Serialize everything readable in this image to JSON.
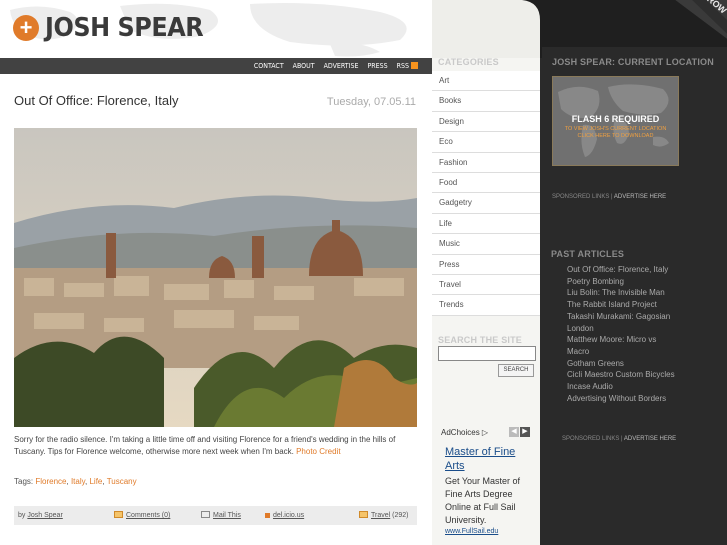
{
  "brand": {
    "logo_symbol": "+",
    "name": "JOSH SPEAR",
    "accent": "#e07b2a"
  },
  "nav": {
    "items": [
      "CONTACT",
      "ABOUT",
      "ADVERTISE",
      "PRESS",
      "RSS"
    ]
  },
  "post": {
    "title": "Out Of Office: Florence, Italy",
    "date": "Tuesday, 07.05.11",
    "body": "Sorry for the radio silence.  I'm taking a little time off and visiting Florence for a friend's wedding in the hills of Tuscany.  Tips for Florence welcome, otherwise more next week when I'm back.",
    "credit": "Photo Credit",
    "tags_label": "Tags:",
    "tags": [
      "Florence",
      "Italy",
      "Life",
      "Tuscany"
    ],
    "footer": {
      "by_label": "by",
      "author": "Josh Spear",
      "comments": "Comments (0)",
      "mail": "Mail This",
      "delicious": "del.icio.us",
      "category": "Travel",
      "category_count": "(292)"
    }
  },
  "categories": {
    "heading": "CATEGORIES",
    "items": [
      "Art",
      "Books",
      "Design",
      "Eco",
      "Fashion",
      "Food",
      "Gadgetry",
      "Life",
      "Music",
      "Press",
      "Travel",
      "Trends"
    ]
  },
  "search": {
    "heading": "SEARCH THE SITE",
    "button": "SEARCH",
    "value": ""
  },
  "ad": {
    "adchoices": "AdChoices",
    "title": "Master of Fine Arts",
    "text": "Get Your Master of Fine Arts Degree Online at Full Sail University.",
    "url": "www.FullSail.edu"
  },
  "location": {
    "heading": "JOSH SPEAR: CURRENT LOCATION",
    "flash_title": "FLASH 6 REQUIRED",
    "flash_sub1": "TO VIEW JOSH'S CURRENT LOCATION",
    "flash_sub2": "CLICK HERE TO DOWNLOAD"
  },
  "sponsored": {
    "label": "SPONSORED LINKS |",
    "link": "ADVERTISE HERE"
  },
  "past": {
    "heading": "PAST ARTICLES",
    "items": [
      "Out Of Office: Florence, Italy",
      "Poetry Bombing",
      "Liu Bolin: The Invisible Man",
      "The Rabbit Island Project",
      "Takashi Murakami: Gagosian London",
      "Matthew Moore: Micro vs Macro",
      "Gotham Greens",
      "Cicli Maestro Custom Bicycles",
      "Incase Audio",
      "Advertising Without Borders"
    ]
  },
  "grow_label": "GROW"
}
